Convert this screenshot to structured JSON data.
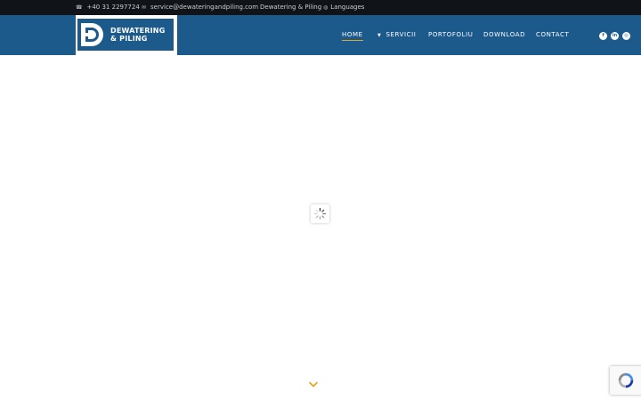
{
  "topbar": {
    "phone": "+40 31 2297724",
    "email": "service@dewateringandpiling.com",
    "company": "Dewatering & Piling",
    "languages": "Languages",
    "icons": [
      "phone-icon",
      "mail-icon",
      "globe-icon"
    ]
  },
  "logo": {
    "line1": "DEWATERING",
    "line2": "& PILING"
  },
  "nav": {
    "items": [
      "HOME",
      "SERVICII",
      "PORTOFOLIU",
      "DOWNLOAD",
      "CONTACT"
    ],
    "active": "HOME"
  },
  "social": {
    "icons": [
      "facebook-icon",
      "linkedin-icon",
      "instagram-icon"
    ]
  },
  "colors": {
    "header": "#1d5a8c",
    "topbar": "#101418",
    "accent": "#e8a317",
    "background": "#ffffff"
  }
}
